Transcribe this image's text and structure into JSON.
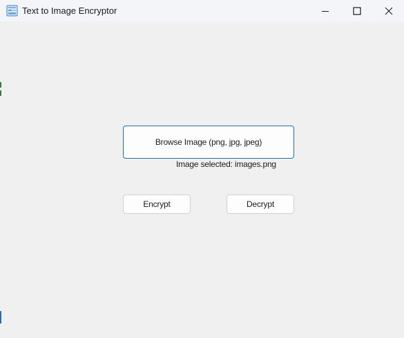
{
  "window": {
    "title": "Text to Image Encryptor",
    "app_icon": "app-image-icon",
    "controls": {
      "minimize_icon": "minimize-icon",
      "maximize_icon": "maximize-icon",
      "close_icon": "close-icon"
    }
  },
  "main": {
    "browse_button_label": "Browse Image (png, jpg, jpeg)",
    "selected_status": "Image selected: images.png",
    "encrypt_button_label": "Encrypt",
    "decrypt_button_label": "Decrypt"
  },
  "colors": {
    "accent_border": "#1f6fb3",
    "window_background": "#f0f0f0",
    "titlebar_background": "#f3f5f8"
  }
}
